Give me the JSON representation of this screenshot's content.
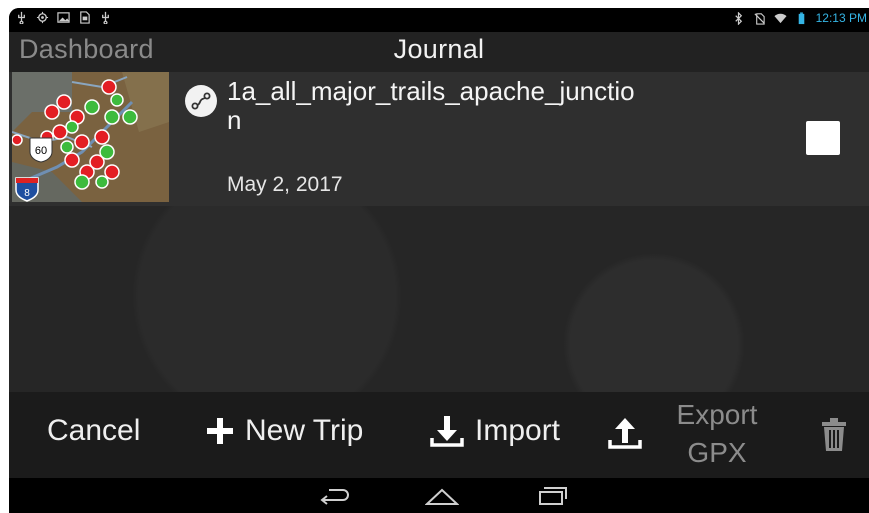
{
  "status_bar": {
    "left_icons": [
      "usb-icon",
      "location-icon",
      "image-icon",
      "sd-card-icon",
      "usb-icon"
    ],
    "right_icons": [
      "bluetooth-icon",
      "no-sim-icon",
      "wifi-icon",
      "battery-icon"
    ],
    "time": "12:13 PM"
  },
  "header": {
    "back_link": "Dashboard",
    "title": "Journal"
  },
  "trips": [
    {
      "name": "1a_all_major_trails_apache_junction",
      "date": "May 2, 2017",
      "icon": "route-icon",
      "selected": false
    }
  ],
  "map_thumbnail": {
    "shields": [
      "60",
      "8"
    ]
  },
  "actions": {
    "cancel": "Cancel",
    "new_trip": "New Trip",
    "import": "Import",
    "export": "Export GPX",
    "export_line1": "Export",
    "export_line2": "GPX",
    "delete_icon": "trash-icon"
  },
  "nav": {
    "icons": [
      "back-icon",
      "home-icon",
      "recents-icon"
    ]
  },
  "colors": {
    "accent_clock": "#35b5e5",
    "background": "#262626",
    "row_background": "#2f2f2f",
    "action_bar": "#1b1b1b"
  }
}
